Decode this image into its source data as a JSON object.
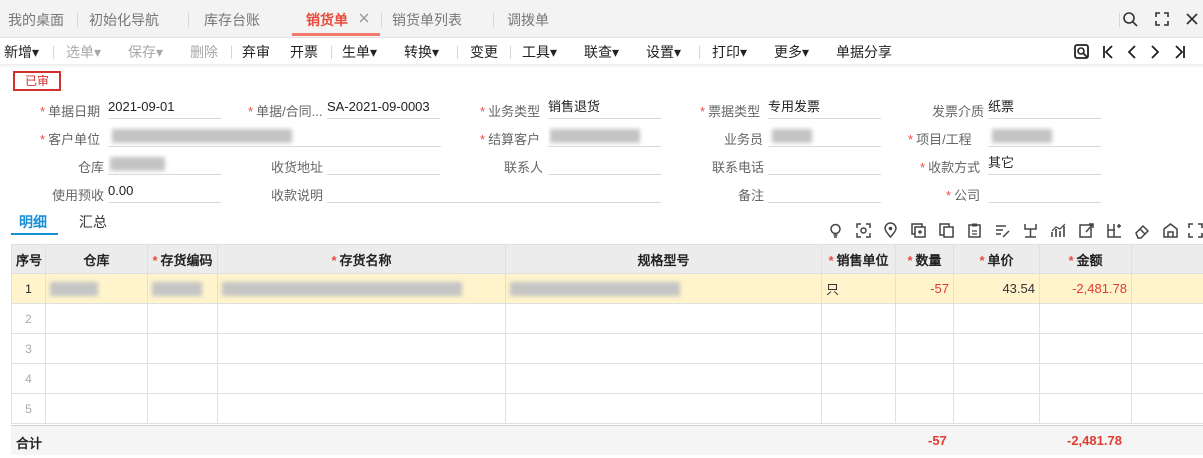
{
  "tabs": [
    {
      "label": "我的桌面"
    },
    {
      "label": "初始化导航"
    },
    {
      "label": "库存台账"
    },
    {
      "label": "销货单"
    },
    {
      "label": "销货单列表"
    },
    {
      "label": "调拨单"
    }
  ],
  "toolbar": {
    "items": [
      "新增▾",
      "选单▾",
      "保存▾",
      "删除",
      "弃审",
      "开票",
      "生单▾",
      "转换▾",
      "变更",
      "工具▾",
      "联查▾",
      "设置▾",
      "打印▾",
      "更多▾",
      "单据分享"
    ]
  },
  "status": "已审",
  "form": {
    "date_label": "单据日期",
    "date_value": "2021-09-01",
    "contract_label": "单据/合同...",
    "contract_value": "SA-2021-09-0003",
    "biz_type_label": "业务类型",
    "biz_type_value": "销售退货",
    "invoice_type_label": "票据类型",
    "invoice_type_value": "专用发票",
    "invoice_media_label": "发票介质",
    "invoice_media_value": "纸票",
    "customer_label": "客户单位",
    "settle_customer_label": "结算客户",
    "salesman_label": "业务员",
    "project_label": "项目/工程",
    "warehouse_label": "仓库",
    "address_label": "收货地址",
    "contact_label": "联系人",
    "phone_label": "联系电话",
    "collect_method_label": "收款方式",
    "collect_method_value": "其它",
    "prepay_label": "使用预收",
    "prepay_value": "0.00",
    "collect_note_label": "收款说明",
    "remark_label": "备注",
    "company_label": "公司"
  },
  "detail_tabs": [
    "明细",
    "汇总"
  ],
  "grid": {
    "headers": [
      "序号",
      "仓库",
      "存货编码",
      "存货名称",
      "规格型号",
      "销售单位",
      "数量",
      "单价",
      "金额"
    ],
    "rows": [
      {
        "seq": "1",
        "unit": "只",
        "qty": "-57",
        "price": "43.54",
        "amount": "-2,481.78"
      },
      {
        "seq": "2"
      },
      {
        "seq": "3"
      },
      {
        "seq": "4"
      },
      {
        "seq": "5"
      }
    ],
    "total_label": "合计",
    "total_qty": "-57",
    "total_amount": "-2,481.78"
  }
}
